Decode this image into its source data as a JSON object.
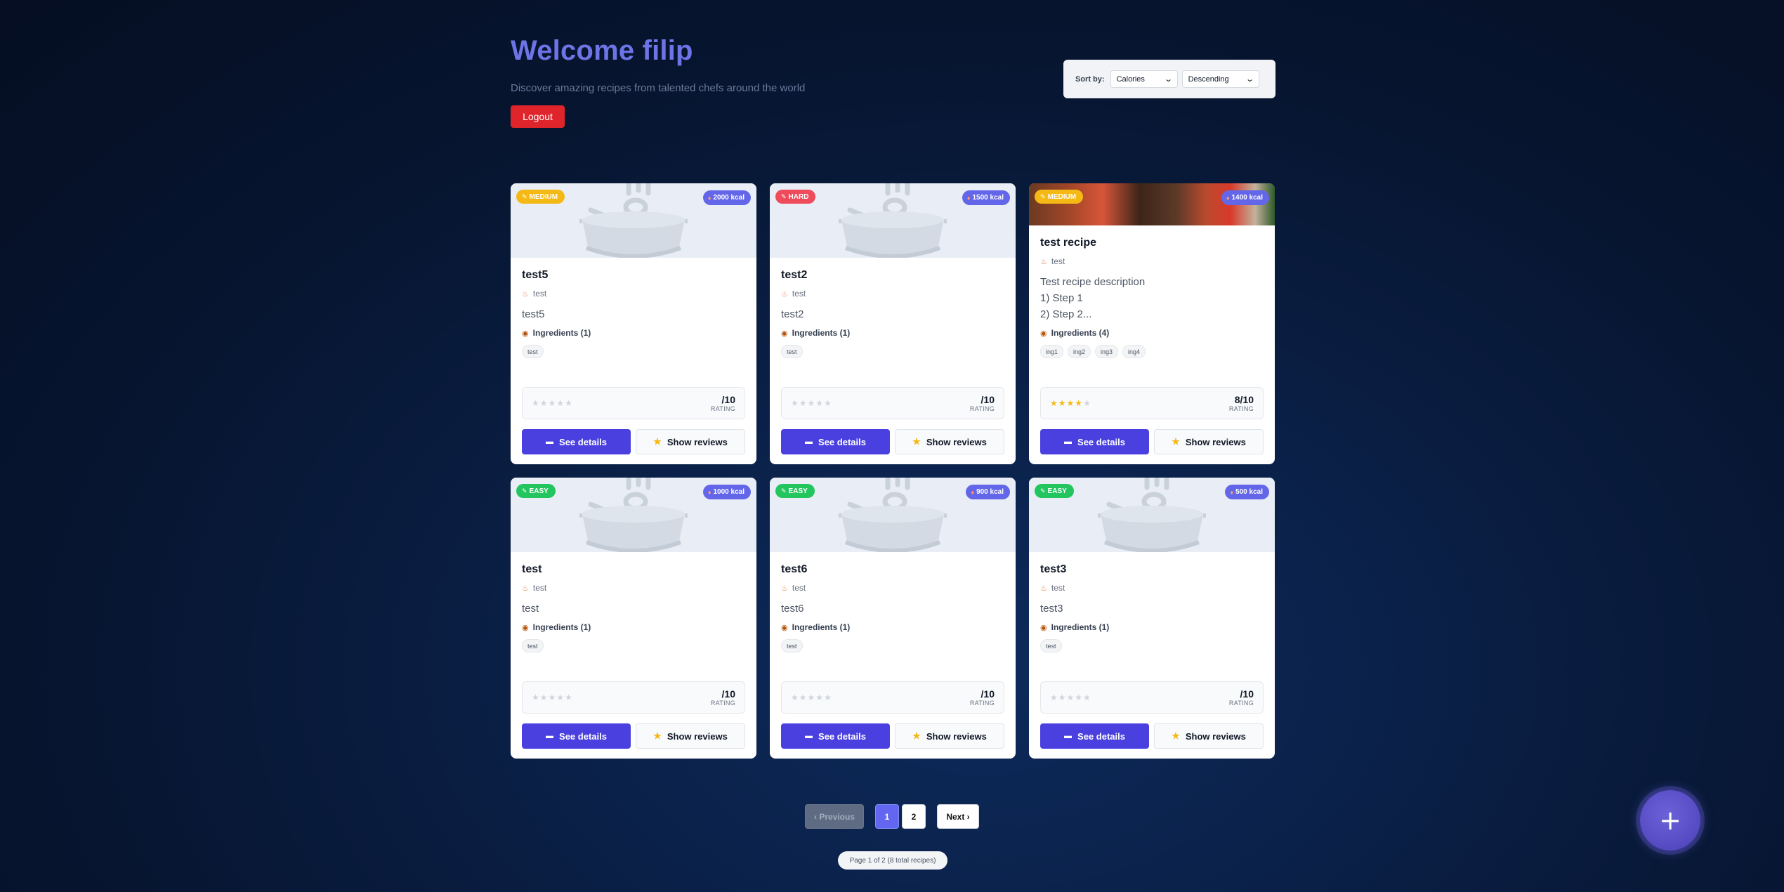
{
  "header": {
    "welcome": "Welcome filip",
    "subtitle": "Discover amazing recipes from talented chefs around the world",
    "logout_label": "Logout"
  },
  "sort": {
    "label": "Sort by:",
    "field": "Calories",
    "order": "Descending"
  },
  "recipes": [
    {
      "difficulty": "MEDIUM",
      "difficulty_color": "#f5b916",
      "kcal": "2000 kcal",
      "title": "test5",
      "author": "test",
      "description": [
        "test5"
      ],
      "ingredients_label": "Ingredients (1)",
      "ingredients": [
        "test"
      ],
      "rating": "/10",
      "rating_label": "RATING",
      "stars_filled": 0,
      "image": "placeholder",
      "details_label": "See details",
      "reviews_label": "Show reviews"
    },
    {
      "difficulty": "HARD",
      "difficulty_color": "#ef4b5b",
      "kcal": "1500 kcal",
      "title": "test2",
      "author": "test",
      "description": [
        "test2"
      ],
      "ingredients_label": "Ingredients (1)",
      "ingredients": [
        "test"
      ],
      "rating": "/10",
      "rating_label": "RATING",
      "stars_filled": 0,
      "image": "placeholder",
      "details_label": "See details",
      "reviews_label": "Show reviews"
    },
    {
      "difficulty": "MEDIUM",
      "difficulty_color": "#f5b916",
      "kcal": "1400 kcal",
      "title": "test recipe",
      "author": "test",
      "description": [
        "Test recipe description",
        "1) Step 1",
        "2) Step 2..."
      ],
      "ingredients_label": "Ingredients (4)",
      "ingredients": [
        "ing1",
        "ing2",
        "ing3",
        "ing4"
      ],
      "rating": "8/10",
      "rating_label": "RATING",
      "stars_filled": 4,
      "image": "photo",
      "details_label": "See details",
      "reviews_label": "Show reviews"
    },
    {
      "difficulty": "EASY",
      "difficulty_color": "#22c55e",
      "kcal": "1000 kcal",
      "title": "test",
      "author": "test",
      "description": [
        "test"
      ],
      "ingredients_label": "Ingredients (1)",
      "ingredients": [
        "test"
      ],
      "rating": "/10",
      "rating_label": "RATING",
      "stars_filled": 0,
      "image": "placeholder",
      "details_label": "See details",
      "reviews_label": "Show reviews"
    },
    {
      "difficulty": "EASY",
      "difficulty_color": "#22c55e",
      "kcal": "900 kcal",
      "title": "test6",
      "author": "test",
      "description": [
        "test6"
      ],
      "ingredients_label": "Ingredients (1)",
      "ingredients": [
        "test"
      ],
      "rating": "/10",
      "rating_label": "RATING",
      "stars_filled": 0,
      "image": "placeholder",
      "details_label": "See details",
      "reviews_label": "Show reviews"
    },
    {
      "difficulty": "EASY",
      "difficulty_color": "#22c55e",
      "kcal": "500 kcal",
      "title": "test3",
      "author": "test",
      "description": [
        "test3"
      ],
      "ingredients_label": "Ingredients (1)",
      "ingredients": [
        "test"
      ],
      "rating": "/10",
      "rating_label": "RATING",
      "stars_filled": 0,
      "image": "placeholder",
      "details_label": "See details",
      "reviews_label": "Show reviews"
    }
  ],
  "pagination": {
    "prev_label": "‹ Previous",
    "pages": [
      "1",
      "2"
    ],
    "current": "1",
    "next_label": "Next ›",
    "info": "Page 1 of 2 (8 total recipes)"
  },
  "fab_label": "+",
  "icons": {
    "difficulty": "chef-hat-icon",
    "kcal": "fire-icon",
    "author": "chef-icon",
    "ingredients": "ingredients-icon",
    "details": "book-icon",
    "reviews": "star-icon",
    "sort": "chevron-down-icon"
  }
}
